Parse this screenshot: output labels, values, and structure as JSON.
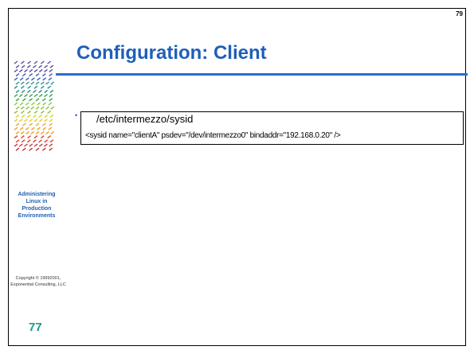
{
  "slide": {
    "corner_number": "79",
    "title": "Configuration: Client",
    "sidebar": {
      "course_title": [
        "Administering",
        "Linux in",
        "Production",
        "Environments"
      ],
      "copyright": [
        "Copyright © 19992001,",
        "Exponential Consulting, LLC"
      ],
      "page_number": "77"
    },
    "content": {
      "bullet_glyph": "•",
      "file_path": "/etc/intermezzo/sysid",
      "code_line": "<sysid name=\"clientA\" psdev=\"/dev/intermezzo0\" bindaddr=\"192.168.0.20\" />"
    }
  },
  "colors": {
    "title": "#1f5fb8",
    "rule": "#2a6fcc",
    "page_number": "#1a9a8a"
  },
  "icons": [
    "logo-icon"
  ]
}
